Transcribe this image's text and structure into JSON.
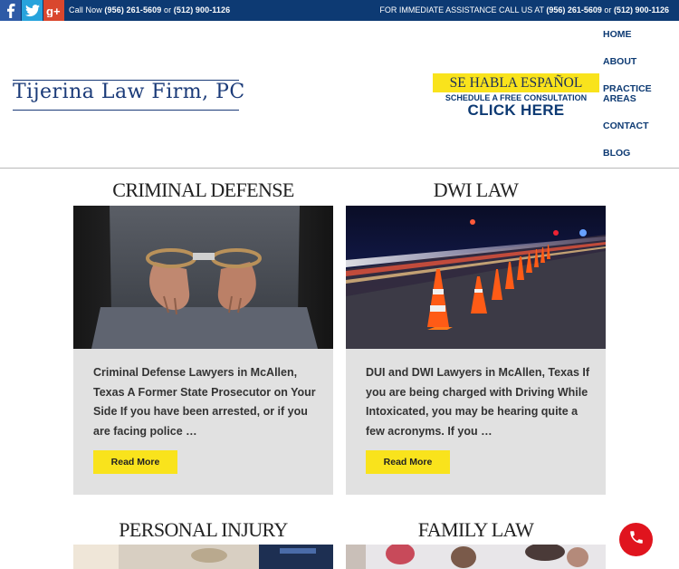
{
  "topbar": {
    "social": [
      {
        "name": "facebook-icon",
        "glyph": "f"
      },
      {
        "name": "twitter-icon",
        "glyph": "t"
      },
      {
        "name": "google-plus-icon",
        "glyph": "g+"
      }
    ],
    "call_prefix": "Call Now ",
    "phone1": "(956) 261-5609",
    "or": " or ",
    "phone2": "(512) 900-1126",
    "assist_prefix": "FOR IMMEDIATE ASSISTANCE CALL US AT ",
    "assist_phone1": "(956) 261-5609",
    "assist_or": " or ",
    "assist_phone2": "(512) 900-1126"
  },
  "header": {
    "logo": "Tijerina Law Firm, PC",
    "spanish": "SE HABLA ESPAÑOL",
    "schedule": "SCHEDULE A FREE CONSULTATION",
    "click_here": "CLICK HERE"
  },
  "nav": {
    "home": "HOME",
    "about": "ABOUT",
    "practice1": "PRACTICE",
    "practice2": "AREAS",
    "contact": "CONTACT",
    "blog": "BLOG"
  },
  "cards": [
    {
      "title": "CRIMINAL DEFENSE",
      "excerpt": "Criminal Defense Lawyers in McAllen, Texas A Former State Prosecutor on Your Side If you have been arrested, or if you are facing police …",
      "button": "Read More"
    },
    {
      "title": "DWI LAW",
      "excerpt": "DUI and DWI Lawyers in McAllen, Texas If you are being charged with Driving While Intoxicated, you may be hearing quite a few acronyms. If you …",
      "button": "Read More"
    },
    {
      "title": "PERSONAL INJURY"
    },
    {
      "title": "FAMILY LAW"
    }
  ],
  "colors": {
    "topbar": "#0d3a73",
    "brand_blue": "#1a3a78",
    "accent_yellow": "#f9e31c",
    "card_gray": "#e1e1e1",
    "call_button": "#e0141e"
  }
}
